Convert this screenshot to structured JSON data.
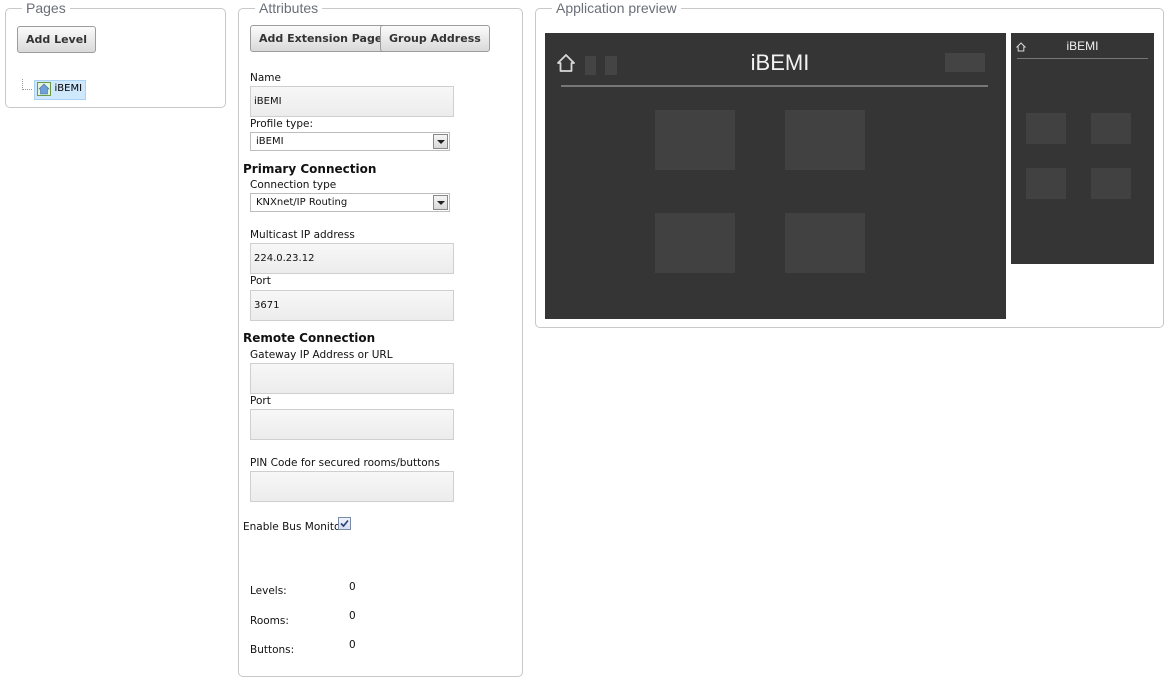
{
  "pages": {
    "legend": "Pages",
    "add_level_label": "Add Level",
    "tree_item_label": "iBEMI"
  },
  "attributes": {
    "legend": "Attributes",
    "add_extension_page_label": "Add Extension Page",
    "group_address_label": "Group Address",
    "name_label": "Name",
    "name_value": "iBEMI",
    "profile_type_label": "Profile type:",
    "profile_type_value": "iBEMI",
    "primary_connection_heading": "Primary Connection",
    "connection_type_label": "Connection type",
    "connection_type_value": "KNXnet/IP Routing",
    "multicast_ip_label": "Multicast IP address",
    "multicast_ip_value": "224.0.23.12",
    "port_label": "Port",
    "port_value": "3671",
    "remote_connection_heading": "Remote Connection",
    "gateway_label": "Gateway IP Address or URL",
    "gateway_value": "",
    "remote_port_label": "Port",
    "remote_port_value": "",
    "pin_label": "PIN Code for secured rooms/buttons",
    "pin_value": "",
    "bus_monitor_label": "Enable Bus Monitor",
    "bus_monitor_checked": true,
    "stats": {
      "levels_label": "Levels:",
      "levels_value": "0",
      "rooms_label": "Rooms:",
      "rooms_value": "0",
      "buttons_label": "Buttons:",
      "buttons_value": "0"
    }
  },
  "preview": {
    "legend": "Application preview",
    "tablet_title": "iBEMI",
    "phone_title": "iBEMI"
  },
  "colors": {
    "preview_background": "#353535",
    "preview_tile": "#414141",
    "legend_text": "#6a6f78",
    "selected_tree_item": "#cfe8fc"
  }
}
